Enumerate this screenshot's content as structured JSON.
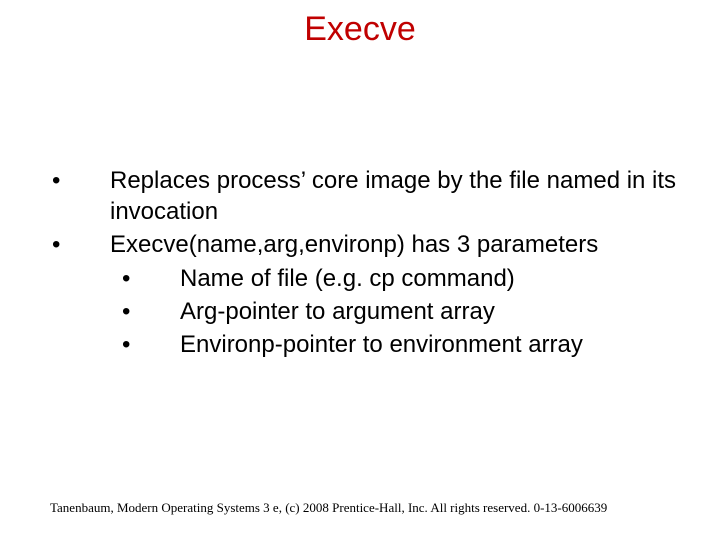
{
  "title": "Execve",
  "bullets": {
    "b1": "Replaces process’ core image by the file named in its invocation",
    "b2": "Execve(name,arg,environp) has 3 parameters",
    "b2a": "Name of file (e.g. cp command)",
    "b2b": "Arg-pointer to argument array",
    "b2c": "Environp-pointer to environment array"
  },
  "glyphs": {
    "dot": "•"
  },
  "footer": "Tanenbaum, Modern Operating Systems 3 e, (c) 2008 Prentice-Hall, Inc. All rights reserved. 0-13-6006639"
}
